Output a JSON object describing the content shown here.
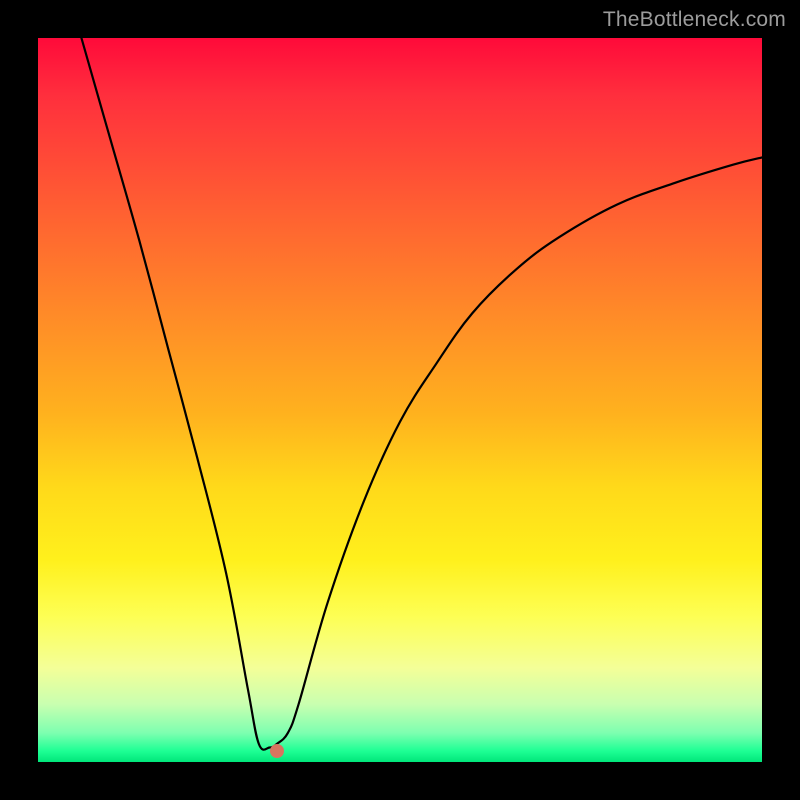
{
  "watermark": "TheBottleneck.com",
  "chart_data": {
    "type": "line",
    "title": "",
    "xlabel": "",
    "ylabel": "",
    "xlim": [
      0,
      100
    ],
    "ylim": [
      0,
      100
    ],
    "grid": false,
    "series": [
      {
        "name": "bottleneck-curve",
        "x": [
          6,
          10,
          14,
          18,
          22,
          26,
          29,
          30.5,
          32,
          33,
          34.5,
          36,
          40,
          45,
          50,
          55,
          60,
          66,
          72,
          80,
          88,
          96,
          100
        ],
        "y": [
          100,
          86,
          72,
          57,
          42,
          26,
          10,
          2.5,
          2,
          2.5,
          4,
          8,
          22,
          36,
          47,
          55,
          62,
          68,
          72.5,
          77,
          80,
          82.5,
          83.5
        ]
      }
    ],
    "marker": {
      "x": 33,
      "y": 1.5,
      "color": "#d7745f"
    },
    "background_gradient": {
      "top": "#ff0a3a",
      "mid": "#ffd91a",
      "bottom": "#00e67a"
    }
  }
}
